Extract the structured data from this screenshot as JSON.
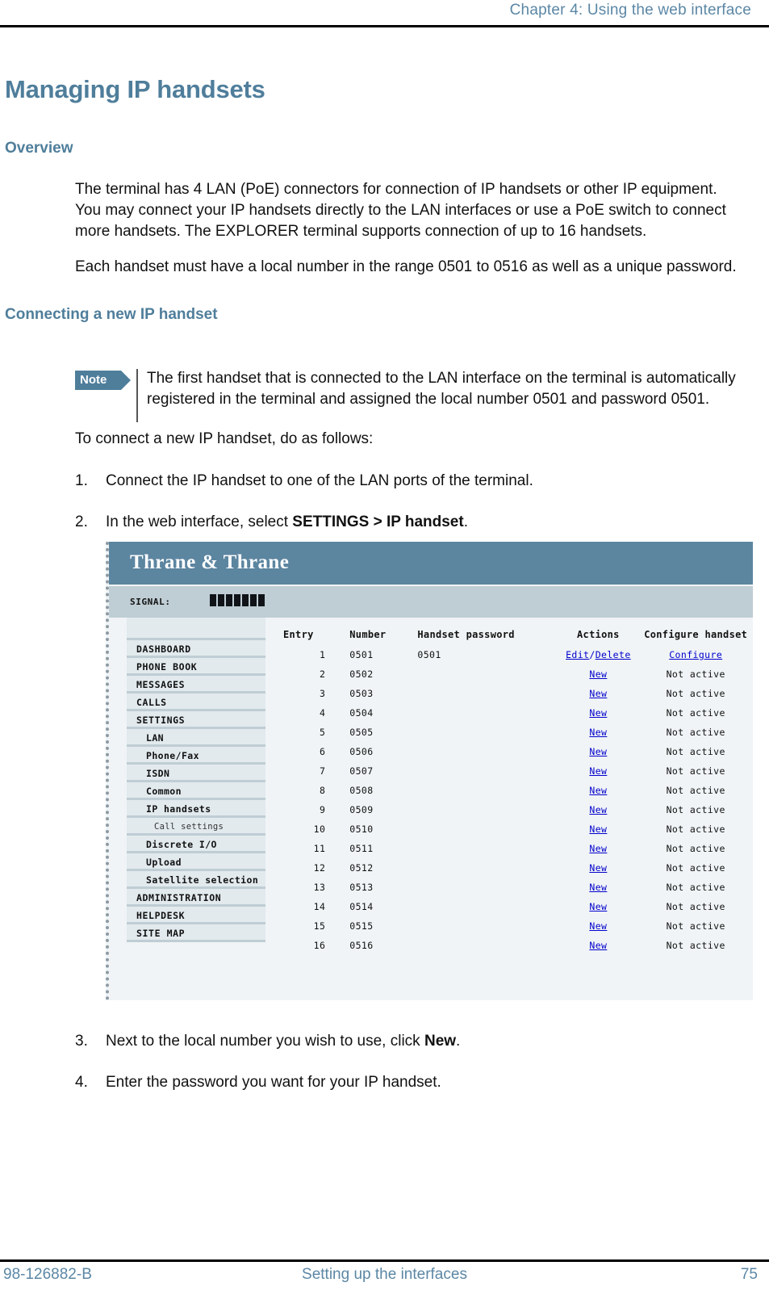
{
  "header": {
    "running_head": "Chapter 4: Using the web interface"
  },
  "document": {
    "title": "Managing IP handsets",
    "sections": [
      {
        "heading": "Overview"
      },
      {
        "heading": "Connecting a new IP handset"
      }
    ],
    "paragraphs": {
      "p1": "The terminal has 4 LAN (PoE) connectors for connection of IP handsets or other IP equipment. You may connect your IP handsets directly to the LAN interfaces or use a PoE switch to connect more handsets. The EXPLORER terminal supports connection of up to 16 handsets.",
      "p2": "Each handset must have a local number in the range 0501 to 0516 as well as a unique password.",
      "intro": "To connect a new IP handset, do as follows:"
    },
    "note": {
      "label": "Note",
      "text": "The first handset that is connected to the LAN interface on the terminal is automatically registered in the terminal and assigned the local number 0501 and password 0501."
    },
    "steps": [
      {
        "num": "1.",
        "text": "Connect the IP handset to one of the LAN ports of the terminal."
      },
      {
        "num": "2.",
        "text_before": "In the web interface, select ",
        "bold": "SETTINGS > IP handset",
        "text_after": "."
      },
      {
        "num": "3.",
        "text_before": "Next to the local number you wish to use, click ",
        "bold": "New",
        "text_after": "."
      },
      {
        "num": "4.",
        "text": "Enter the password you want for your IP handset."
      }
    ]
  },
  "webui": {
    "brand": "Thrane & Thrane",
    "signal_label": "SIGNAL:",
    "signal_bars": 7,
    "menu": [
      {
        "label": "DASHBOARD",
        "level": 1
      },
      {
        "label": "PHONE BOOK",
        "level": 1
      },
      {
        "label": "MESSAGES",
        "level": 1
      },
      {
        "label": "CALLS",
        "level": 1
      },
      {
        "label": "SETTINGS",
        "level": 1
      },
      {
        "label": "LAN",
        "level": 2
      },
      {
        "label": "Phone/Fax",
        "level": 2
      },
      {
        "label": "ISDN",
        "level": 2
      },
      {
        "label": "Common",
        "level": 2
      },
      {
        "label": "IP handsets",
        "level": 2
      },
      {
        "label": "Call settings",
        "level": 3
      },
      {
        "label": "Discrete I/O",
        "level": 2
      },
      {
        "label": "Upload",
        "level": 2
      },
      {
        "label": "Satellite selection",
        "level": 2
      },
      {
        "label": "ADMINISTRATION",
        "level": 1
      },
      {
        "label": "HELPDESK",
        "level": 1
      },
      {
        "label": "SITE MAP",
        "level": 1
      }
    ],
    "table": {
      "columns": [
        "Entry",
        "Number",
        "Handset password",
        "Actions",
        "Configure handset"
      ],
      "rows": [
        {
          "entry": "1",
          "number": "0501",
          "password": "0501",
          "actions": "Edit/Delete",
          "action_links": [
            "Edit",
            "Delete"
          ],
          "configure": "Configure",
          "configure_is_link": true
        },
        {
          "entry": "2",
          "number": "0502",
          "password": "",
          "actions": "New",
          "action_links": [
            "New"
          ],
          "configure": "Not active",
          "configure_is_link": false
        },
        {
          "entry": "3",
          "number": "0503",
          "password": "",
          "actions": "New",
          "action_links": [
            "New"
          ],
          "configure": "Not active",
          "configure_is_link": false
        },
        {
          "entry": "4",
          "number": "0504",
          "password": "",
          "actions": "New",
          "action_links": [
            "New"
          ],
          "configure": "Not active",
          "configure_is_link": false
        },
        {
          "entry": "5",
          "number": "0505",
          "password": "",
          "actions": "New",
          "action_links": [
            "New"
          ],
          "configure": "Not active",
          "configure_is_link": false
        },
        {
          "entry": "6",
          "number": "0506",
          "password": "",
          "actions": "New",
          "action_links": [
            "New"
          ],
          "configure": "Not active",
          "configure_is_link": false
        },
        {
          "entry": "7",
          "number": "0507",
          "password": "",
          "actions": "New",
          "action_links": [
            "New"
          ],
          "configure": "Not active",
          "configure_is_link": false
        },
        {
          "entry": "8",
          "number": "0508",
          "password": "",
          "actions": "New",
          "action_links": [
            "New"
          ],
          "configure": "Not active",
          "configure_is_link": false
        },
        {
          "entry": "9",
          "number": "0509",
          "password": "",
          "actions": "New",
          "action_links": [
            "New"
          ],
          "configure": "Not active",
          "configure_is_link": false
        },
        {
          "entry": "10",
          "number": "0510",
          "password": "",
          "actions": "New",
          "action_links": [
            "New"
          ],
          "configure": "Not active",
          "configure_is_link": false
        },
        {
          "entry": "11",
          "number": "0511",
          "password": "",
          "actions": "New",
          "action_links": [
            "New"
          ],
          "configure": "Not active",
          "configure_is_link": false
        },
        {
          "entry": "12",
          "number": "0512",
          "password": "",
          "actions": "New",
          "action_links": [
            "New"
          ],
          "configure": "Not active",
          "configure_is_link": false
        },
        {
          "entry": "13",
          "number": "0513",
          "password": "",
          "actions": "New",
          "action_links": [
            "New"
          ],
          "configure": "Not active",
          "configure_is_link": false
        },
        {
          "entry": "14",
          "number": "0514",
          "password": "",
          "actions": "New",
          "action_links": [
            "New"
          ],
          "configure": "Not active",
          "configure_is_link": false
        },
        {
          "entry": "15",
          "number": "0515",
          "password": "",
          "actions": "New",
          "action_links": [
            "New"
          ],
          "configure": "Not active",
          "configure_is_link": false
        },
        {
          "entry": "16",
          "number": "0516",
          "password": "",
          "actions": "New",
          "action_links": [
            "New"
          ],
          "configure": "Not active",
          "configure_is_link": false
        }
      ]
    }
  },
  "footer": {
    "left": "98-126882-B",
    "center": "Setting up the interfaces",
    "right": "75"
  },
  "colors": {
    "accent_blue": "#4f7e9b",
    "header_text": "#5b87a5",
    "brandbar": "#5c85a0",
    "signalbar": "#bfcdd4",
    "menu_item": "#e2eaee",
    "menu_divider": "#bfcdd4",
    "ui_background": "#f0f4f6",
    "link": "#0000cc"
  }
}
